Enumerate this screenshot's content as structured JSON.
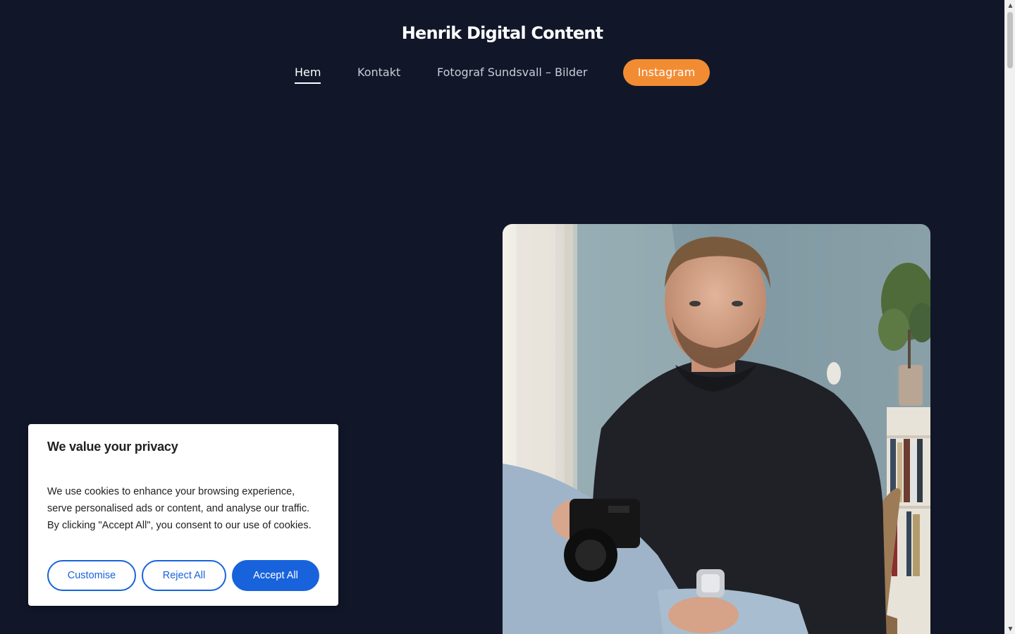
{
  "header": {
    "site_title": "Henrik Digital Content"
  },
  "nav": {
    "items": [
      {
        "label": "Hem",
        "active": true
      },
      {
        "label": "Kontakt",
        "active": false
      },
      {
        "label": "Fotograf Sundsvall – Bilder",
        "active": false
      }
    ],
    "cta_label": "Instagram",
    "cta_color": "#f28c33"
  },
  "hero": {
    "photo": "portrait-of-man-seated-in-armchair-holding-camera"
  },
  "cookie_banner": {
    "title": "We value your privacy",
    "body": "We use cookies to enhance your browsing experience, serve personalised ads or content, and analyse our traffic. By clicking \"Accept All\", you consent to our use of cookies.",
    "customise_label": "Customise",
    "reject_label": "Reject All",
    "accept_label": "Accept All",
    "accent_color": "#1863dc"
  },
  "theme": {
    "background": "#111729"
  }
}
